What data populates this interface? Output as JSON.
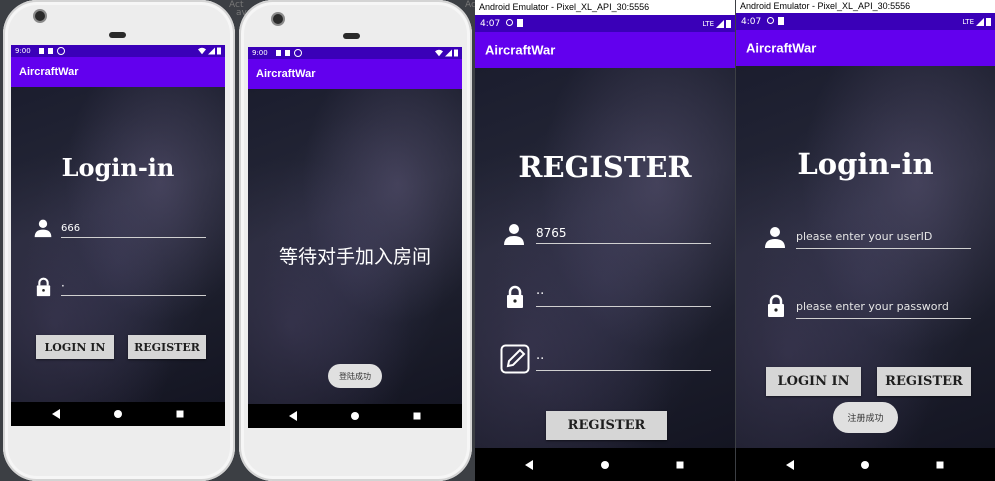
{
  "screens": [
    {
      "status_time": "9:00",
      "app_title": "AircraftWar",
      "heading": "Login-in",
      "user_value": "666",
      "password_value": "·",
      "login_button": "LOGIN IN",
      "register_button": "REGISTER"
    },
    {
      "status_time": "9:00",
      "app_title": "AircraftWar",
      "waiting_text": "等待对手加入房间",
      "toast_text": "登陆成功"
    },
    {
      "window_title": "Android Emulator - Pixel_XL_API_30:5556",
      "status_time": "4:07",
      "network": "LTE",
      "app_title": "AircraftWar",
      "heading": "REGISTER",
      "user_value": "8765",
      "password_value": "··",
      "confirm_value": "··",
      "register_button": "REGISTER"
    },
    {
      "window_title": "Android Emulator - Pixel_XL_API_30:5556",
      "status_time": "4:07",
      "network": "LTE",
      "app_title": "AircraftWar",
      "heading": "Login-in",
      "user_placeholder": "please enter your userID",
      "password_placeholder": "please enter your password",
      "login_button": "LOGIN IN",
      "register_button": "REGISTER",
      "toast_text": "注册成功"
    }
  ],
  "background_text": [
    "Act",
    "Act",
    "ava"
  ],
  "colors": {
    "app_bar": "#6200ee",
    "status_bar": "#3a00b8",
    "button": "#d6d6d6",
    "toast": "#e0e0e0"
  },
  "icons": [
    "person-icon",
    "lock-icon",
    "edit-icon",
    "back-icon",
    "home-icon",
    "recents-icon",
    "wifi-icon",
    "signal-icon",
    "battery-icon"
  ]
}
